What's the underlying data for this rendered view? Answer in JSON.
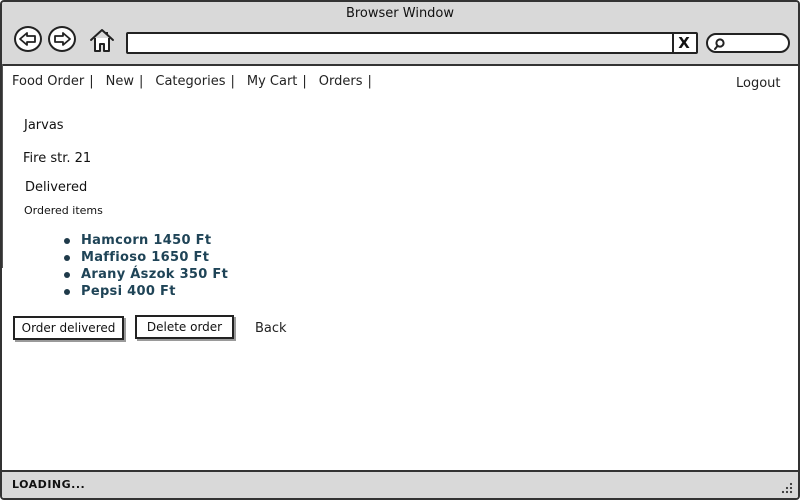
{
  "window": {
    "title": "Browser Window"
  },
  "toolbar": {
    "back_icon": "back-arrow-icon",
    "forward_icon": "forward-arrow-icon",
    "home_icon": "home-icon",
    "address_value": "",
    "address_clear": "X",
    "search_icon": "search-icon"
  },
  "menu": {
    "items": [
      {
        "label": "Food Order",
        "sep": "|"
      },
      {
        "label": "New",
        "sep": "|"
      },
      {
        "label": "Categories",
        "sep": "|"
      },
      {
        "label": "My Cart",
        "sep": "|"
      },
      {
        "label": "Orders",
        "sep": "|"
      }
    ],
    "logout": "Logout"
  },
  "order": {
    "customer_name": "Jarvas",
    "address": "Fire str. 21",
    "status": "Delivered",
    "items_label": "Ordered items",
    "items": [
      "Hamcorn 1450 Ft",
      "Maffioso 1650 Ft",
      "Arany Ászok 350 Ft",
      "Pepsi 400 Ft"
    ]
  },
  "actions": {
    "order_delivered": "Order delivered",
    "delete_order": "Delete order",
    "back": "Back"
  },
  "status_bar": {
    "text": "LOADING..."
  },
  "colors": {
    "chrome": "#d9d9d9",
    "item_text": "#1f4457",
    "border": "#222222"
  }
}
